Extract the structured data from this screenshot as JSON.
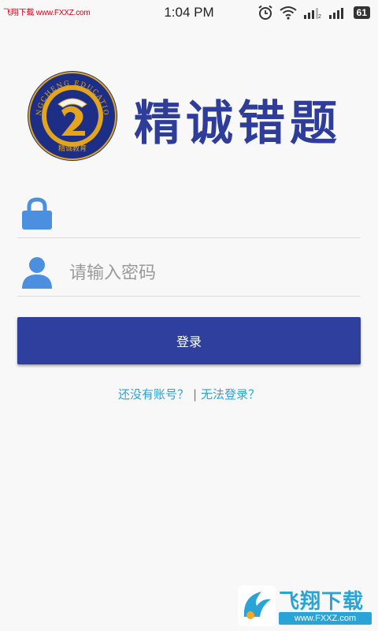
{
  "status_bar": {
    "watermark": "飞翔下载 www.FXXZ.com",
    "time": "1:04 PM",
    "battery": "61",
    "icons": [
      "alarm-icon",
      "wifi-icon",
      "signal-icon",
      "signal-icon",
      "battery-icon"
    ]
  },
  "logo": {
    "title": "精诚错题",
    "seal_top_text": "JINGCHENG EDUCATION",
    "seal_bottom_text": "精诚教育",
    "colors": {
      "title": "#2e3c9a",
      "seal_ring": "#1d2e86",
      "seal_gold": "#e2a51c"
    }
  },
  "form": {
    "account_field": {
      "value": "",
      "placeholder": "",
      "icon": "lock-icon"
    },
    "password_field": {
      "value": "",
      "placeholder": "请输入密码",
      "icon": "user-icon"
    },
    "login_button": "登录"
  },
  "links": {
    "register": "还没有账号？",
    "separator": "|",
    "cannot_login": "无法登录？"
  },
  "watermark": {
    "name": "飞翔下载",
    "url": "www.FXXZ.com"
  },
  "colors": {
    "primary": "#2f3f9e",
    "icon_blue": "#4a8fe0",
    "link": "#2aa3d6",
    "background": "#f8f8f8"
  }
}
